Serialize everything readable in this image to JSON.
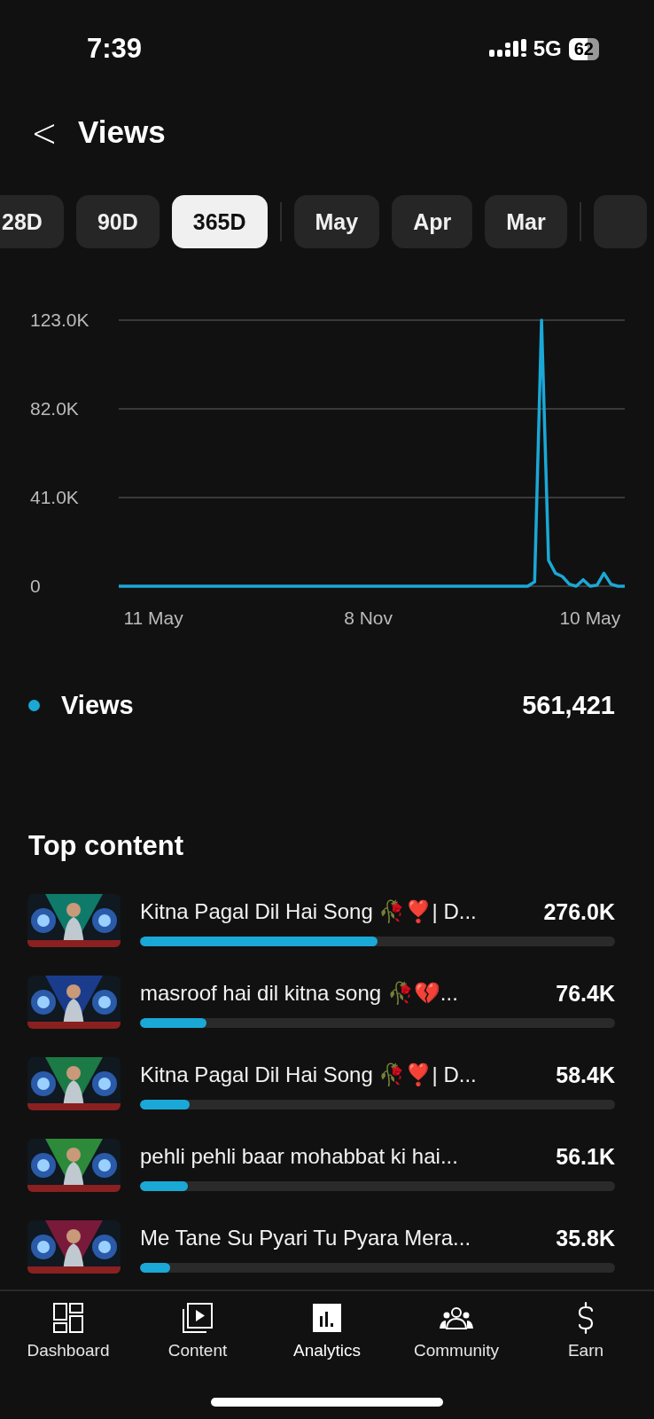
{
  "status_bar": {
    "time": "7:39",
    "network": "5G",
    "battery": "62"
  },
  "header": {
    "back": "<",
    "title": "Views"
  },
  "tabs": [
    {
      "label": "28D",
      "selected": false,
      "divider_before": false
    },
    {
      "label": "90D",
      "selected": false,
      "divider_before": false
    },
    {
      "label": "365D",
      "selected": true,
      "divider_before": false
    },
    {
      "label": "May",
      "selected": false,
      "divider_before": true
    },
    {
      "label": "Apr",
      "selected": false,
      "divider_before": false
    },
    {
      "label": "Mar",
      "selected": false,
      "divider_before": false
    }
  ],
  "chart_data": {
    "type": "line",
    "categories": [
      null,
      null,
      null,
      null,
      null,
      "11 May",
      null,
      null,
      null,
      null,
      null,
      null,
      null,
      null,
      null,
      null,
      null,
      null,
      null,
      null,
      null,
      null,
      null,
      null,
      null,
      null,
      null,
      null,
      null,
      null,
      null,
      null,
      null,
      null,
      null,
      null,
      "8 Nov",
      null,
      null,
      null,
      null,
      null,
      null,
      null,
      null,
      null,
      null,
      null,
      null,
      null,
      null,
      null,
      null,
      null,
      null,
      null,
      null,
      null,
      null,
      null,
      null,
      null,
      null,
      null,
      null,
      null,
      null,
      null,
      "10 May",
      null,
      null,
      null,
      null,
      null
    ],
    "ylim": [
      0,
      123000
    ],
    "yticks": [
      {
        "value": 0,
        "label": "0"
      },
      {
        "value": 41000,
        "label": "41.0K"
      },
      {
        "value": 82000,
        "label": "82.0K"
      },
      {
        "value": 123000,
        "label": "123.0K"
      }
    ],
    "series": [
      {
        "name": "Views",
        "color": "#1aa8d6",
        "values": [
          0,
          0,
          0,
          0,
          0,
          0,
          0,
          0,
          0,
          0,
          0,
          0,
          0,
          0,
          0,
          0,
          0,
          0,
          0,
          0,
          0,
          0,
          0,
          0,
          0,
          0,
          0,
          0,
          0,
          0,
          0,
          0,
          0,
          0,
          0,
          0,
          0,
          0,
          0,
          0,
          0,
          0,
          0,
          0,
          0,
          0,
          0,
          0,
          0,
          0,
          0,
          0,
          0,
          0,
          0,
          0,
          0,
          0,
          0,
          0,
          2000,
          123000,
          12000,
          6000,
          4500,
          1000,
          0,
          3000,
          0,
          500,
          6000,
          1000,
          0,
          0
        ]
      }
    ]
  },
  "summary": {
    "value": "561,421"
  },
  "top_content": {
    "title": "Top content",
    "items": [
      {
        "title": "Kitna Pagal Dil Hai Song 🥀❣️| D...",
        "views": "276.0K",
        "level": 0.5
      },
      {
        "title": "masroof hai dil kitna song 🥀💔...",
        "views": "76.4K",
        "level": 0.14
      },
      {
        "title": "Kitna Pagal Dil Hai Song 🥀❣️| D...",
        "views": "58.4K",
        "level": 0.105
      },
      {
        "title": "pehli pehli baar mohabbat ki hai...",
        "views": "56.1K",
        "level": 0.1
      },
      {
        "title": "Me Tane Su Pyari Tu Pyara Mera...",
        "views": "35.8K",
        "level": 0.064
      }
    ]
  },
  "nav": [
    {
      "label": "Dashboard",
      "kind": "dashboard",
      "selected": false
    },
    {
      "label": "Content",
      "kind": "content",
      "selected": false
    },
    {
      "label": "Analytics",
      "kind": "analytics",
      "selected": true
    },
    {
      "label": "Community",
      "kind": "community",
      "selected": false
    },
    {
      "label": "Earn",
      "kind": "earn",
      "selected": false
    }
  ]
}
